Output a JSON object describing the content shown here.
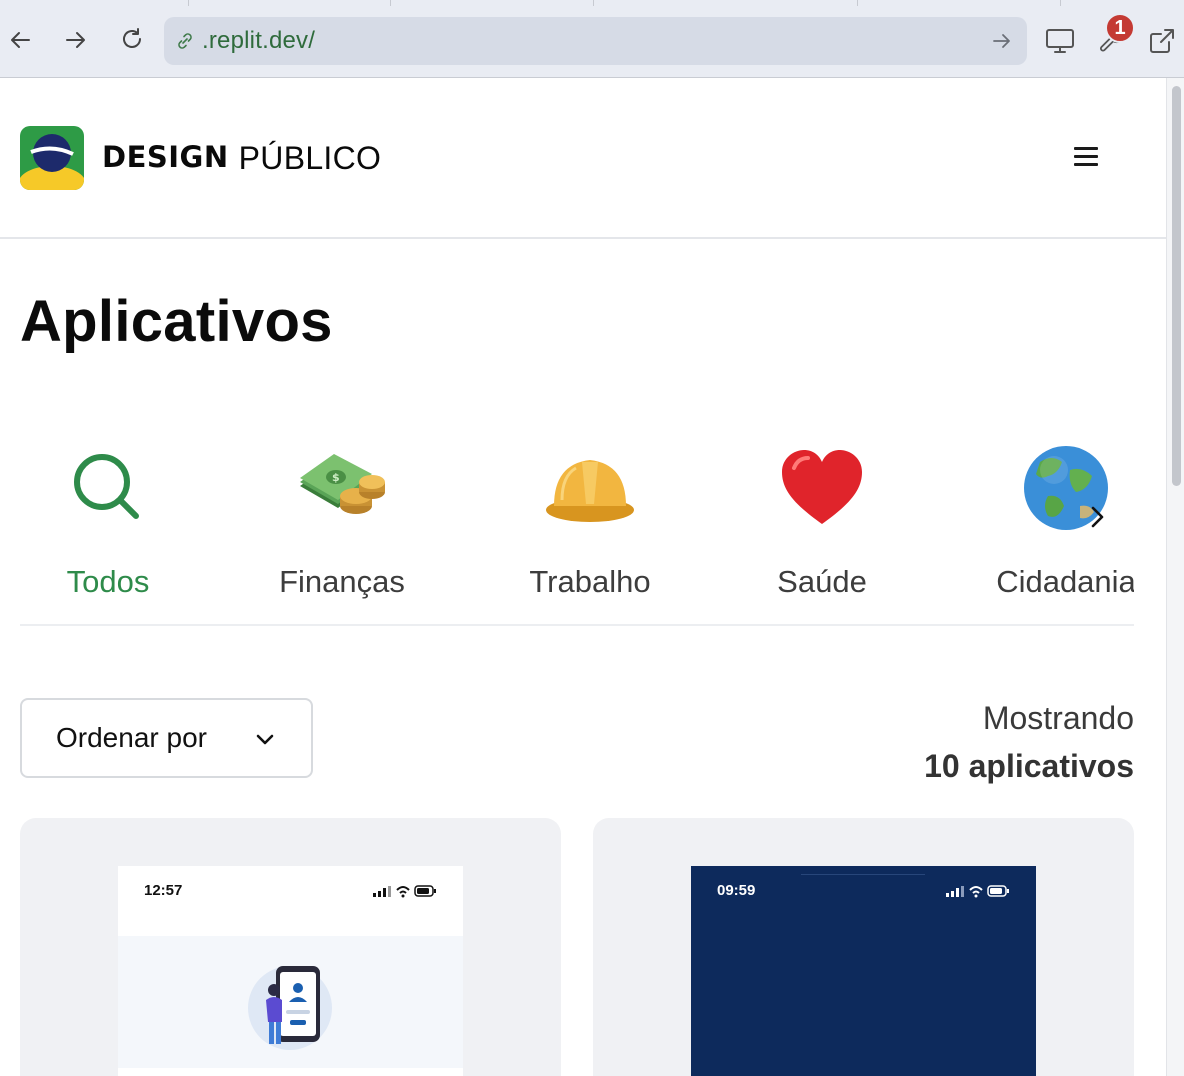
{
  "browser": {
    "url": ".replit.dev/",
    "notification_count": "1"
  },
  "header": {
    "brand_bold": "DESIGN",
    "brand_regular": "PÚBLICO"
  },
  "page": {
    "title": "Aplicativos"
  },
  "categories": [
    {
      "label": "Todos",
      "icon": "search-icon",
      "active": true
    },
    {
      "label": "Finanças",
      "icon": "money-icon",
      "active": false
    },
    {
      "label": "Trabalho",
      "icon": "hard-hat-icon",
      "active": false
    },
    {
      "label": "Saúde",
      "icon": "heart-icon",
      "active": false
    },
    {
      "label": "Cidadania",
      "icon": "globe-icon",
      "active": false
    }
  ],
  "toolbar": {
    "sort_label": "Ordenar por",
    "showing_line1": "Mostrando",
    "showing_line2": "10 aplicativos"
  },
  "cards": [
    {
      "time": "12:57",
      "theme": "light"
    },
    {
      "time": "09:59",
      "theme": "dark"
    }
  ],
  "colors": {
    "accent": "#2e8b4a",
    "brand_green": "#2e9b46",
    "brand_yellow": "#f6c928",
    "brand_blue": "#1d2a6b",
    "card_bg": "#f0f1f4",
    "dark_screen": "#0d2a5c",
    "badge": "#c43a33"
  }
}
